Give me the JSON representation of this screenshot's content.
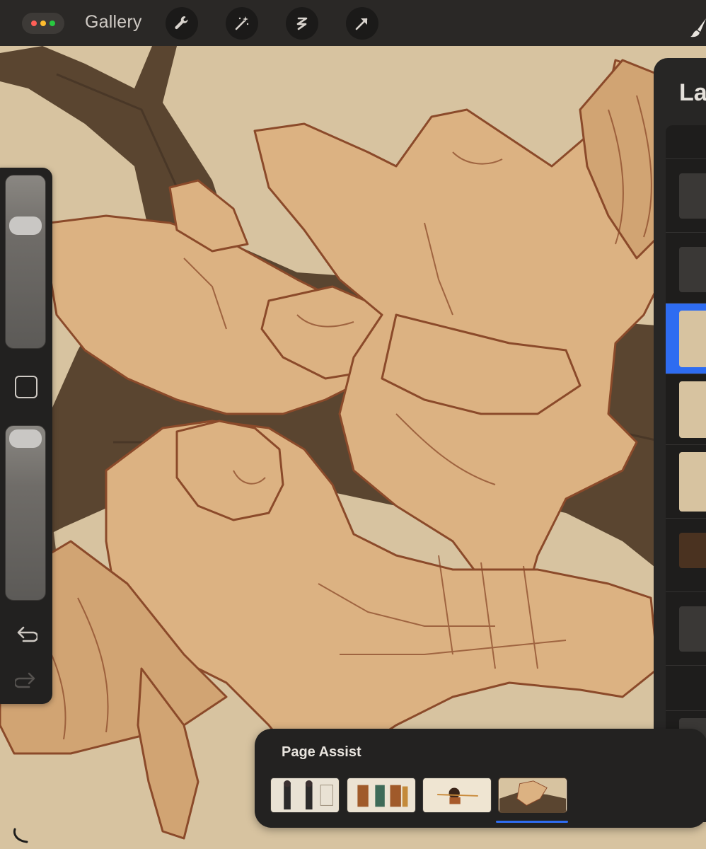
{
  "topbar": {
    "gallery_label": "Gallery",
    "tools": [
      "wrench-icon",
      "magic-wand-icon",
      "selection-icon",
      "transform-arrow-icon"
    ],
    "window_dots": [
      "#ff5f57",
      "#febc2e",
      "#28c840"
    ]
  },
  "layers": {
    "title": "La",
    "selected_color": "#2e6cf1"
  },
  "page_assist": {
    "title": "Page Assist",
    "pages": [
      "page-1",
      "page-2",
      "page-3",
      "page-4"
    ],
    "active_page": 4
  },
  "canvas": {
    "background": "#d7c3a0",
    "branch_color": "#5a4530",
    "line_color": "#8b4a2a",
    "fill_color": "#dcb282"
  }
}
